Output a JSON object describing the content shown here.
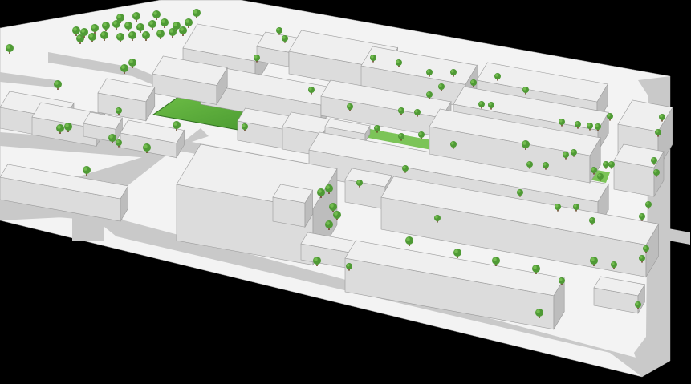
{
  "scene": {
    "kind": "3d-massing-model",
    "subject": "urban-block-aerial",
    "highlight": "green-space-and-linear-path"
  },
  "colors": {
    "background": "#000000",
    "ground": "#f3f3f3",
    "street": "#c9c9c9",
    "roof": "#efefef",
    "wall_light": "#dcdcdc",
    "wall_dark": "#bdbdbd",
    "outline": "#9a9a9a",
    "tree": "#4f9a35",
    "tree_light": "#7cc456",
    "tree_trunk": "#6b4a2a",
    "park": "#3f8f2a",
    "park_light": "#6fbf47"
  }
}
